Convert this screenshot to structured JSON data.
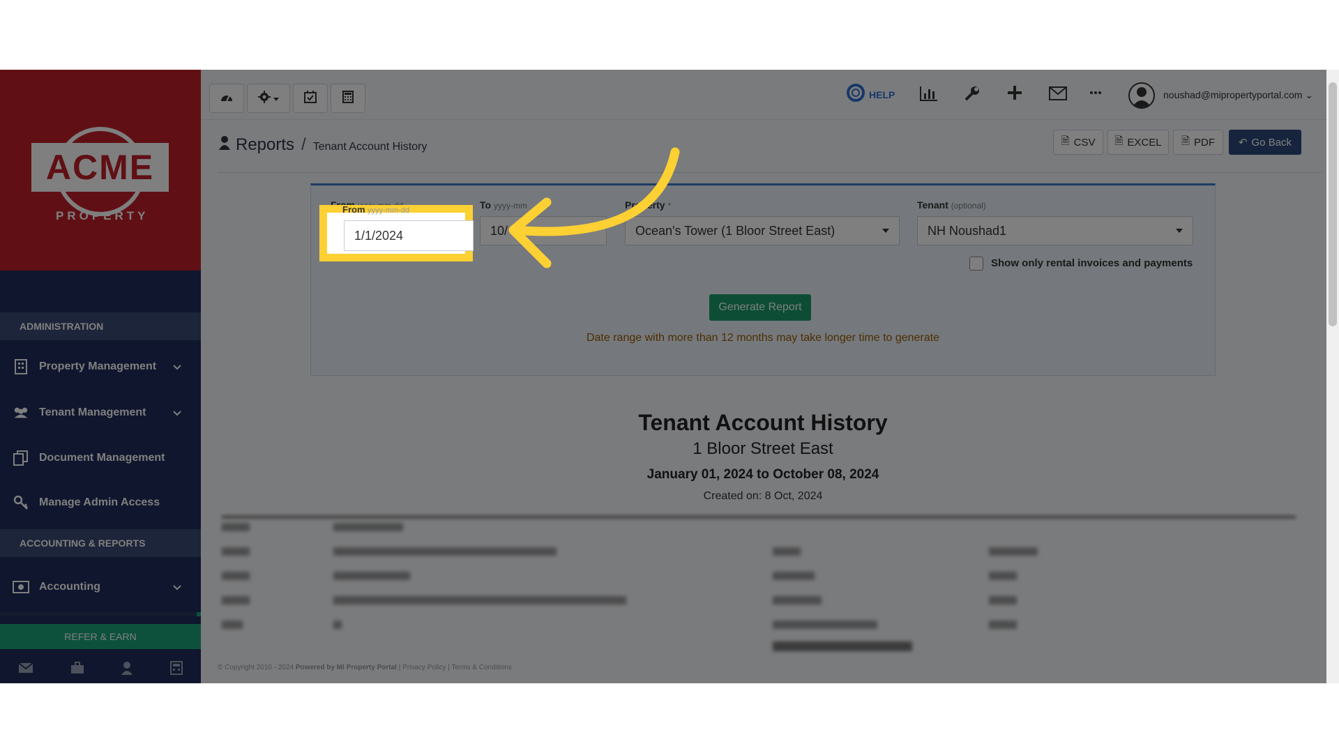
{
  "brand": {
    "logo_text": "ACME",
    "logo_sub": "PROPERTY",
    "primary_color": "#c0212a",
    "sidebar_color": "#1e2d5a"
  },
  "sidebar": {
    "admin_header": "ADMINISTRATION",
    "accounting_header": "ACCOUNTING & REPORTS",
    "items": [
      {
        "label": "Property Management",
        "icon": "building-icon",
        "has_chevron": true
      },
      {
        "label": "Tenant Management",
        "icon": "users-icon",
        "has_chevron": true
      },
      {
        "label": "Document Management",
        "icon": "documents-icon",
        "has_chevron": false
      },
      {
        "label": "Manage Admin Access",
        "icon": "key-icon",
        "has_chevron": false
      }
    ],
    "accounting_item": {
      "label": "Accounting",
      "icon": "money-icon",
      "has_chevron": true
    },
    "refer_label": "REFER & EARN",
    "bottom_icons": [
      "mail-icon",
      "briefcase-icon",
      "user-icon",
      "calculator-icon"
    ]
  },
  "topbar": {
    "left_icons": [
      "dashboard-icon",
      "gear-icon",
      "calendar-check-icon",
      "calculator-icon"
    ],
    "help_label": "HELP",
    "right_icons": [
      "bar-chart-icon",
      "wrench-icon",
      "plus-icon",
      "envelope-icon",
      "ellipsis-icon"
    ],
    "user_email": "noushad@mipropertyportal.com"
  },
  "breadcrumb": {
    "title": "Reports",
    "separator": "/",
    "sub": "Tenant Account History"
  },
  "actions": {
    "csv": "CSV",
    "excel": "EXCEL",
    "pdf": "PDF",
    "go_back": "Go Back"
  },
  "form": {
    "from_label": "From",
    "from_hint": "yyyy-mm-dd",
    "from_value": "1/1/2024",
    "to_label": "To",
    "to_hint": "yyyy-mm",
    "to_value": "10/",
    "property_label": "Property",
    "property_required": "*",
    "property_value": "Ocean's Tower (1 Bloor Street East)",
    "tenant_label": "Tenant",
    "tenant_optional": "(optional)",
    "tenant_value": "NH Noushad1",
    "checkbox_label": "Show only rental invoices and payments",
    "checkbox_checked": false,
    "generate_button": "Generate Report",
    "warning": "Date range with more than 12 months may take longer time to generate"
  },
  "report": {
    "title": "Tenant Account History",
    "address": "1 Bloor Street East",
    "range": "January 01, 2024 to October 08, 2024",
    "created": "Created on: 8 Oct, 2024"
  },
  "footer": {
    "copyright": "© Copyright 2016 - 2024",
    "powered": "Powered by MI Property Portal",
    "privacy": "Privacy Policy",
    "terms": "Terms & Conditions"
  },
  "overlay": {
    "highlight_color": "#fdd033"
  }
}
